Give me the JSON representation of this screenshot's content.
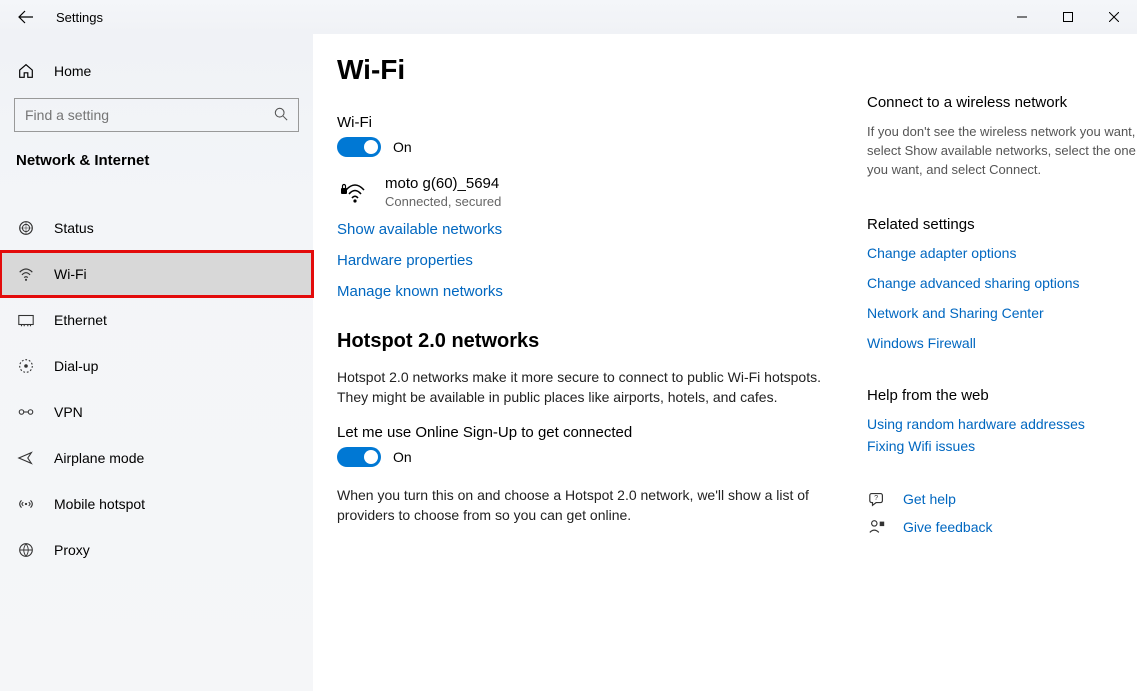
{
  "window": {
    "title": "Settings"
  },
  "sidebar": {
    "home": "Home",
    "search_placeholder": "Find a setting",
    "category": "Network & Internet",
    "items": [
      {
        "label": "Status",
        "icon": "status-icon",
        "selected": false
      },
      {
        "label": "Wi-Fi",
        "icon": "wifi-icon",
        "selected": true
      },
      {
        "label": "Ethernet",
        "icon": "ethernet-icon",
        "selected": false
      },
      {
        "label": "Dial-up",
        "icon": "dialup-icon",
        "selected": false
      },
      {
        "label": "VPN",
        "icon": "vpn-icon",
        "selected": false
      },
      {
        "label": "Airplane mode",
        "icon": "airplane-icon",
        "selected": false
      },
      {
        "label": "Mobile hotspot",
        "icon": "hotspot-icon",
        "selected": false
      },
      {
        "label": "Proxy",
        "icon": "proxy-icon",
        "selected": false
      }
    ]
  },
  "page": {
    "heading": "Wi-Fi",
    "wifi_section_label": "Wi-Fi",
    "wifi_toggle_state": "On",
    "network": {
      "name": "moto g(60)_5694",
      "status": "Connected, secured"
    },
    "link_show_available": "Show available networks",
    "link_hardware_props": "Hardware properties",
    "link_manage_known": "Manage known networks",
    "hotspot": {
      "heading": "Hotspot 2.0 networks",
      "body1": "Hotspot 2.0 networks make it more secure to connect to public Wi-Fi hotspots. They might be available in public places like airports, hotels, and cafes.",
      "signup_label": "Let me use Online Sign-Up to get connected",
      "signup_state": "On",
      "body2": "When you turn this on and choose a Hotspot 2.0 network, we'll show a list of providers to choose from so you can get online."
    }
  },
  "right": {
    "connect": {
      "heading": "Connect to a wireless network",
      "body": "If you don't see the wireless network you want, select Show available networks, select the one you want, and select Connect."
    },
    "related": {
      "heading": "Related settings",
      "links": [
        "Change adapter options",
        "Change advanced sharing options",
        "Network and Sharing Center",
        "Windows Firewall"
      ]
    },
    "help": {
      "heading": "Help from the web",
      "links": [
        "Using random hardware addresses",
        "Fixing Wifi issues"
      ]
    },
    "assist": {
      "get_help": "Get help",
      "feedback": "Give feedback"
    }
  }
}
